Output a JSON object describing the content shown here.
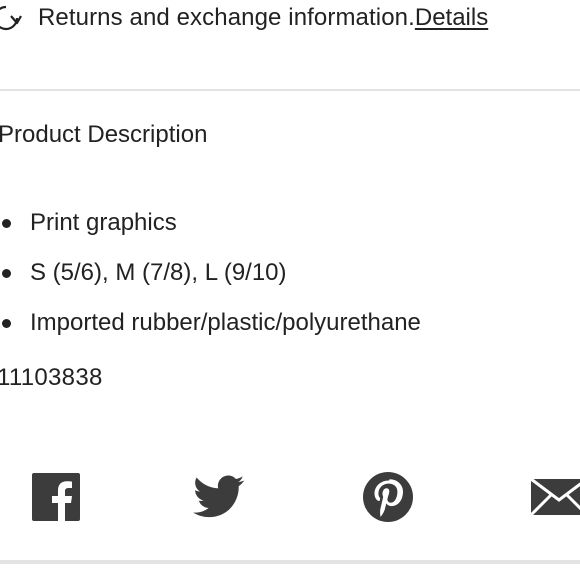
{
  "returns": {
    "icon": "refresh-arrow-icon",
    "text": "Returns and exchange information.",
    "details_label": "Details"
  },
  "description": {
    "title": "Product Description",
    "bullets": [
      "Print graphics",
      "S (5/6), M (7/8), L (9/10)",
      "Imported rubber/plastic/polyurethane"
    ],
    "sku": "11103838"
  },
  "share": {
    "icons": [
      "facebook-icon",
      "twitter-icon",
      "pinterest-icon",
      "email-icon"
    ],
    "icon_color": "#3c3c3c"
  },
  "colors": {
    "text": "#222222",
    "divider": "#e2e2e2"
  }
}
